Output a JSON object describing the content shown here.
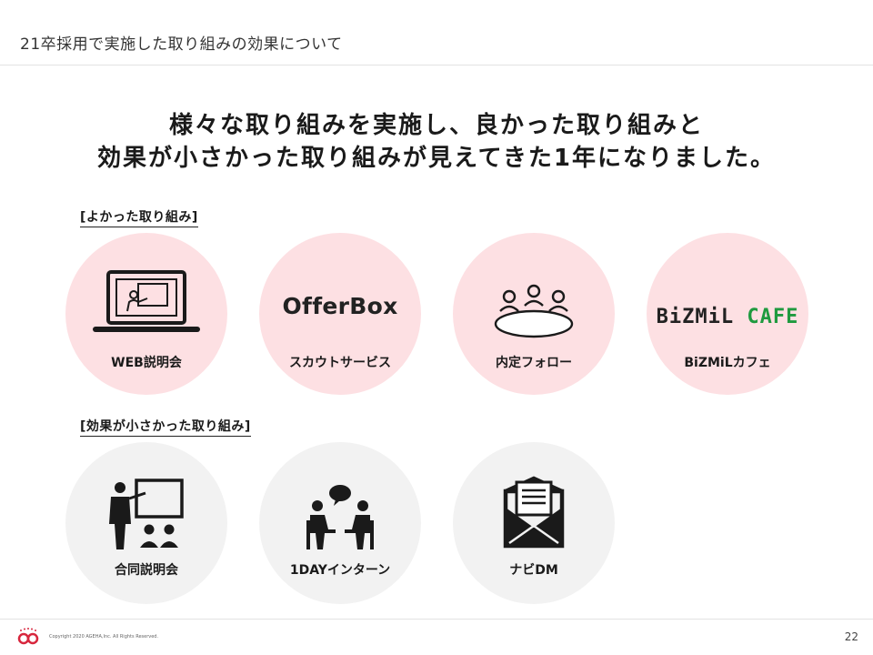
{
  "header": {
    "title": "21卒採用で実施した取り組みの効果について"
  },
  "headline": {
    "line1": "様々な取り組みを実施し、良かった取り組みと",
    "line2": "効果が小さかった取り組みが見えてきた1年になりました。"
  },
  "good_section": {
    "label": "[よかった取り組み]",
    "items": [
      {
        "label": "WEB説明会",
        "icon": "laptop-presentation-icon"
      },
      {
        "label": "スカウトサービス",
        "logo_text": "OfferBox"
      },
      {
        "label": "内定フォロー",
        "icon": "meeting-table-icon"
      },
      {
        "label": "BiZMiLカフェ",
        "logo_main": "BiZMiL",
        "logo_accent": "CAFE"
      }
    ]
  },
  "bad_section": {
    "label": "[効果が小さかった取り組み]",
    "items": [
      {
        "label": "合同説明会",
        "icon": "seminar-presenter-icon"
      },
      {
        "label": "1DAYインターン",
        "icon": "conversation-icon"
      },
      {
        "label": "ナビDM",
        "icon": "envelope-letter-icon"
      }
    ]
  },
  "colors": {
    "good_circle": "#fde0e3",
    "bad_circle": "#f2f2f2",
    "cafe_green": "#1f9a3f",
    "logo_red": "#d7263d"
  },
  "footer": {
    "copyright": "Copyright 2020 AGEHA,Inc. All Rights Reserved.",
    "page_number": "22"
  }
}
